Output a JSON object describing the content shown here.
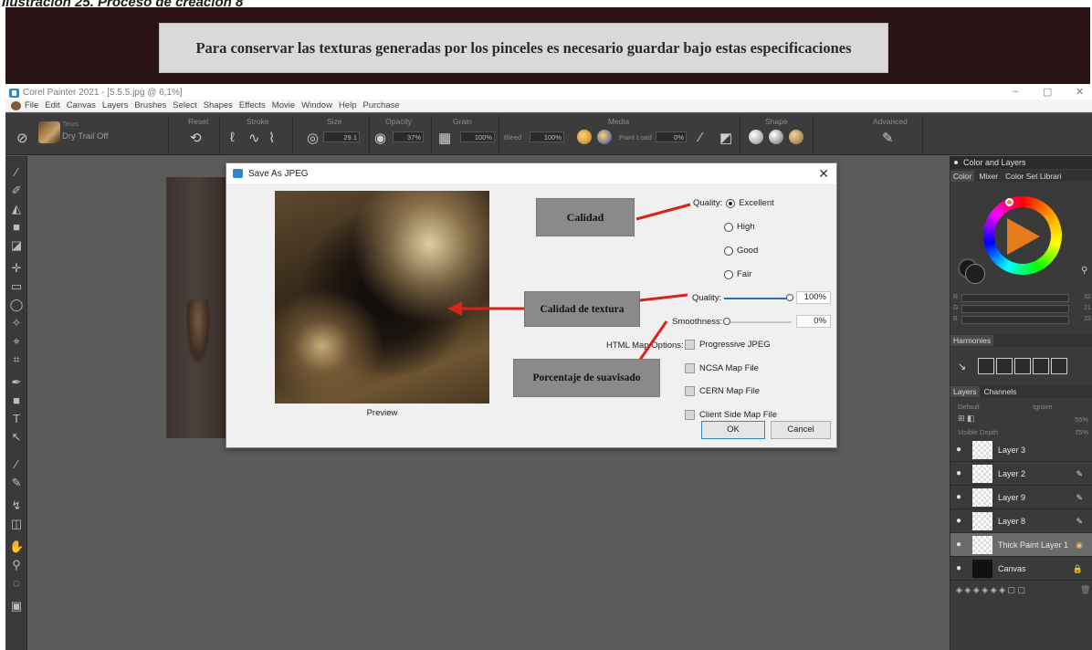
{
  "document": {
    "caption": "Ilustración 25. Proceso de creación 8",
    "banner_text": "Para conservar las texturas generadas por los pinceles es necesario guardar bajo estas especificaciones"
  },
  "app": {
    "title": "Corel Painter 2021 - [5.5.5.jpg @ 6,1%]",
    "menu": [
      "File",
      "Edit",
      "Canvas",
      "Layers",
      "Brushes",
      "Select",
      "Shapes",
      "Effects",
      "Movie",
      "Window",
      "Help",
      "Purchase"
    ],
    "window_controls": [
      "–",
      "▢",
      "✕"
    ],
    "property_bar": {
      "brush_category": "Texas",
      "brush_name": "Dry Trail Off",
      "sections": [
        "Reset",
        "Stroke",
        "Size",
        "Opacity",
        "Grain",
        "Media",
        "Shape",
        "Advanced"
      ],
      "size_value": "29.1",
      "opacity_value": "37%",
      "grain_value": "100%",
      "bleed_label": "Bleed",
      "bleed_value": "100%",
      "paint_load_label": "Paint Load",
      "paint_load_value": "0%"
    }
  },
  "dialog": {
    "title": "Save As JPEG",
    "preview_label": "Preview",
    "quality_label": "Quality:",
    "quality_options": [
      "Excellent",
      "High",
      "Good",
      "Fair"
    ],
    "selected_quality": "Excellent",
    "texture_quality_label": "Quality:",
    "texture_quality_value": "100%",
    "texture_quality_fraction": 1.0,
    "smoothness_label": "Smoothness:",
    "smoothness_value": "0%",
    "smoothness_fraction": 0.0,
    "html_map_label": "HTML Map Options:",
    "checkboxes": [
      "Progressive JPEG",
      "NCSA Map File",
      "CERN Map File",
      "Client Side Map File"
    ],
    "ok_label": "OK",
    "cancel_label": "Cancel"
  },
  "annotations": {
    "calidad": "Calidad",
    "calidad_textura": "Calidad de textura",
    "suavisado": "Porcentaje de suavisado",
    "arrow_color": "#d9221b"
  },
  "panel": {
    "color_layers_title": "Color and Layers",
    "color_tabs": [
      "Color",
      "Mixer",
      "Color Set Librari"
    ],
    "rgb_labels": [
      "R",
      "G",
      "B"
    ],
    "rgb_values": [
      "32",
      "21",
      "23"
    ],
    "harmonies_title": "Harmonies",
    "layers_tabs": [
      "Layers",
      "Channels"
    ],
    "composite_method": "Default",
    "ignore_label": "Ignore",
    "opacity_value": "55%",
    "visible_depth_label": "Visible Depth",
    "visible_depth_value": "75%",
    "layers": [
      "Layer 3",
      "Layer 2",
      "Layer 9",
      "Layer 8",
      "Thick Paint Layer 1",
      "Canvas"
    ],
    "selected_layer": "Thick Paint Layer 1",
    "primary_color": "#f08a20"
  }
}
